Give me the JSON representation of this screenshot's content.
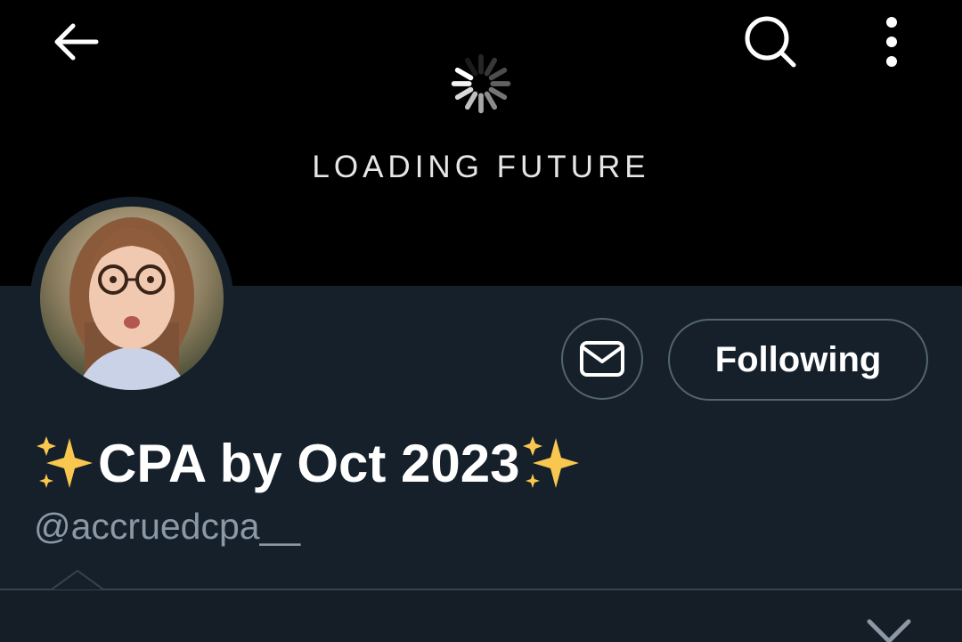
{
  "header": {
    "back_icon": "arrow-left-icon",
    "search_icon": "search-icon",
    "more_icon": "more-vertical-icon"
  },
  "banner": {
    "spinner_icon": "loading-spinner-icon",
    "text": "LOADING FUTURE",
    "background": "#000000"
  },
  "profile": {
    "avatar_icon": "avatar",
    "display_name": "CPA by Oct 2023",
    "name_emoji": "sparkles-icon",
    "handle": "@accruedcpa__"
  },
  "actions": {
    "message_icon": "envelope-icon",
    "follow_label": "Following"
  },
  "tabs": {
    "expand_icon": "chevron-down-icon"
  },
  "colors": {
    "background": "#15202b",
    "border": "#536471",
    "secondary_text": "#8b98a5",
    "sparkle": "#f9c74f"
  }
}
